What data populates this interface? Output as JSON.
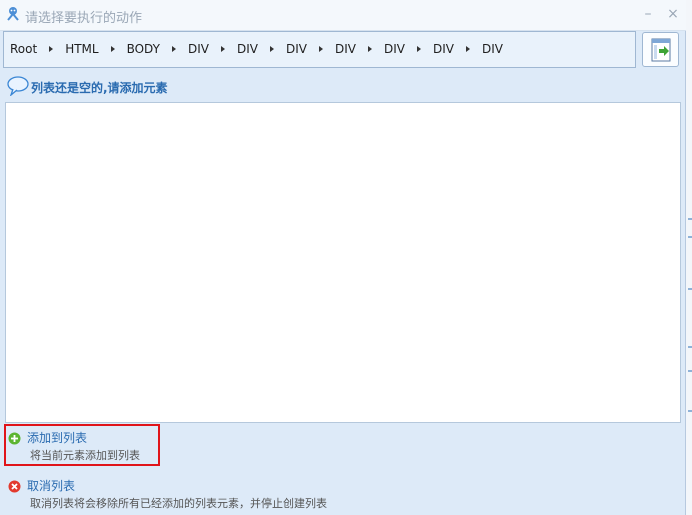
{
  "window": {
    "title": "请选择要执行的动作",
    "minimize": "–",
    "close": "×"
  },
  "breadcrumb": {
    "items": [
      "Root",
      "HTML",
      "BODY",
      "DIV",
      "DIV",
      "DIV",
      "DIV",
      "DIV",
      "DIV",
      "DIV"
    ]
  },
  "hint": {
    "text": "列表还是空的,请添加元素"
  },
  "actions": {
    "add": {
      "title": "添加到列表",
      "desc": "将当前元素添加到列表"
    },
    "cancel": {
      "title": "取消列表",
      "desc": "取消列表将会移除所有已经添加的列表元素，并停止创建列表"
    }
  },
  "colors": {
    "accent": "#2a6bb0",
    "highlight": "#e0141a",
    "add_icon": "#5cb531",
    "cancel_icon": "#e23a2e"
  },
  "icons": {
    "app": "bot-icon",
    "nav": "navigate-enter-icon",
    "hint": "speech-bubble-icon",
    "add": "plus-circle-icon",
    "cancel": "close-circle-icon"
  }
}
